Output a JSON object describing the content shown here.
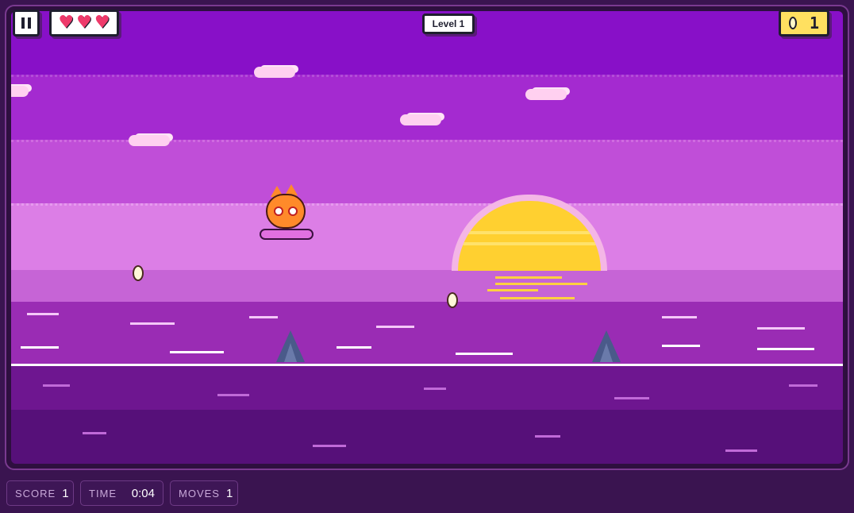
{
  "hud": {
    "pause_icon": "pause-icon",
    "hearts": [
      "♥",
      "♥",
      "♥"
    ],
    "level_label": "Level 1",
    "coin_count": "1"
  },
  "stats": {
    "score_label": "SCORE",
    "score_value": "1",
    "time_label": "TIME",
    "time_value": "0:04",
    "moves_label": "MOVES",
    "moves_value": "1"
  },
  "colors": {
    "sky_top": "#8810c8",
    "sun": "#ffd030",
    "sea": "#9a2cb4",
    "heart": "#ee3a6a",
    "coin_badge": "#ffe060"
  }
}
